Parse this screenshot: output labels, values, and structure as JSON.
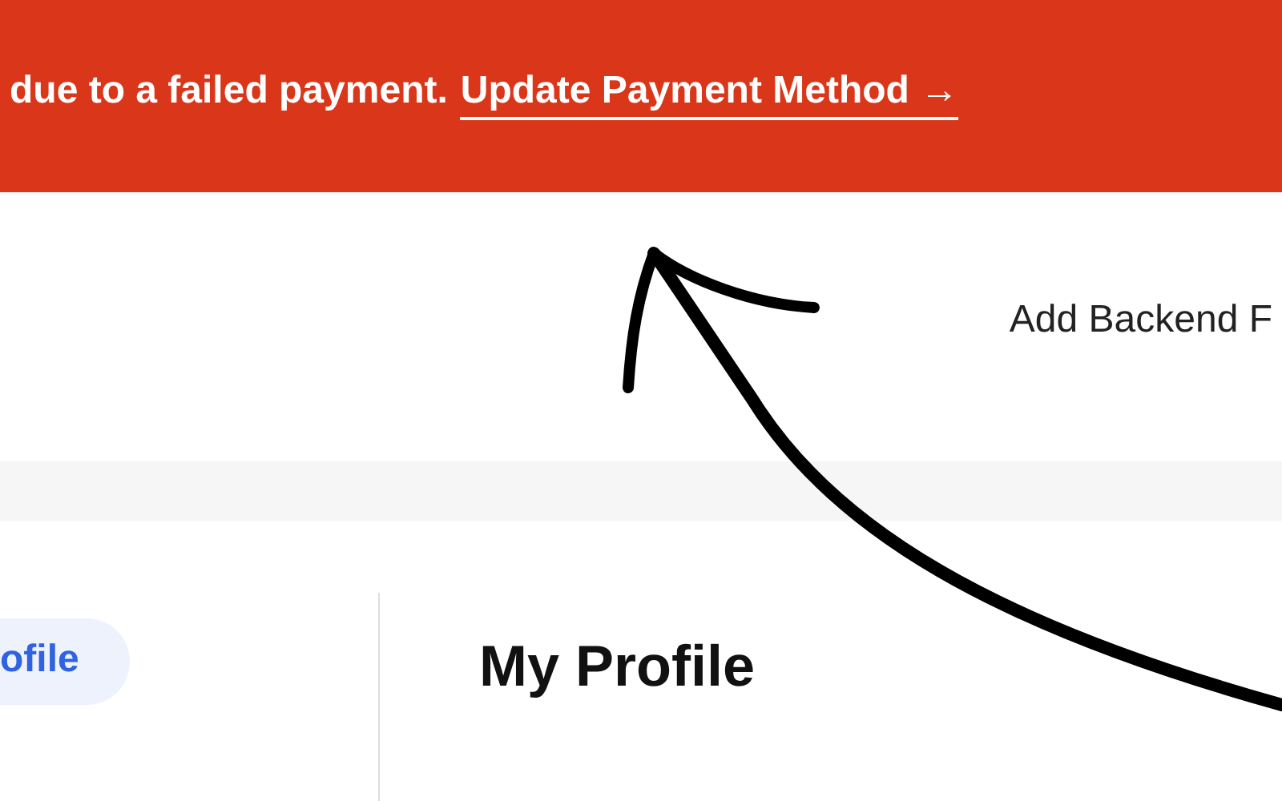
{
  "banner": {
    "message": "due to a failed payment.",
    "link": "Update Payment Method →"
  },
  "header": {
    "action": "Add Backend F"
  },
  "sidebar": {
    "items": [
      {
        "label": "ofile",
        "selected": true
      }
    ]
  },
  "main": {
    "title": "My Profile"
  }
}
